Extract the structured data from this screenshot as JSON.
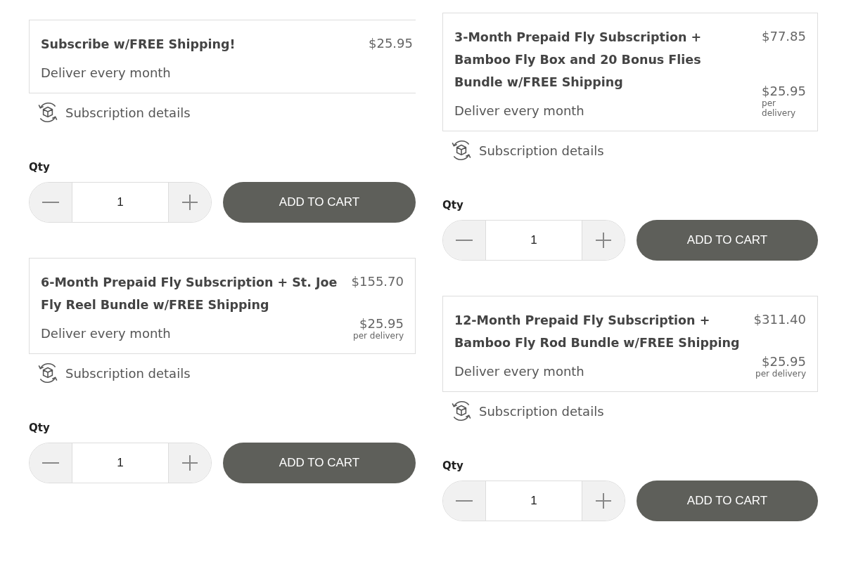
{
  "columns": [
    {
      "panels": [
        {
          "title": "Subscribe w/FREE Shipping!",
          "price": "$25.95",
          "delivery": "Deliver every month",
          "details": "Subscription details",
          "qty_label": "Qty",
          "qty": "1",
          "button": "ADD TO CART"
        },
        {
          "title": "6-Month Prepaid Fly Subscription + St. Joe Fly Reel Bundle w/FREE Shipping",
          "price": "$155.70",
          "delivery": "Deliver every month",
          "per_price": "$25.95",
          "per_label": "per delivery",
          "details": "Subscription details",
          "qty_label": "Qty",
          "qty": "1",
          "button": "ADD TO CART"
        }
      ]
    },
    {
      "panels": [
        {
          "title": "3-Month Prepaid Fly Subscription + Bamboo Fly Box and 20 Bonus Flies Bundle w/FREE Shipping",
          "price": "$77.85",
          "delivery": "Deliver every month",
          "per_price": "$25.95",
          "per_label": "per delivery",
          "details": "Subscription details",
          "qty_label": "Qty",
          "qty": "1",
          "button": "ADD TO CART"
        },
        {
          "title": "12-Month Prepaid Fly Subscription + Bamboo Fly Rod Bundle w/FREE Shipping",
          "price": "$311.40",
          "delivery": "Deliver every month",
          "per_price": "$25.95",
          "per_label": "per delivery",
          "details": "Subscription details",
          "qty_label": "Qty",
          "qty": "1",
          "button": "ADD TO CART"
        }
      ]
    }
  ]
}
